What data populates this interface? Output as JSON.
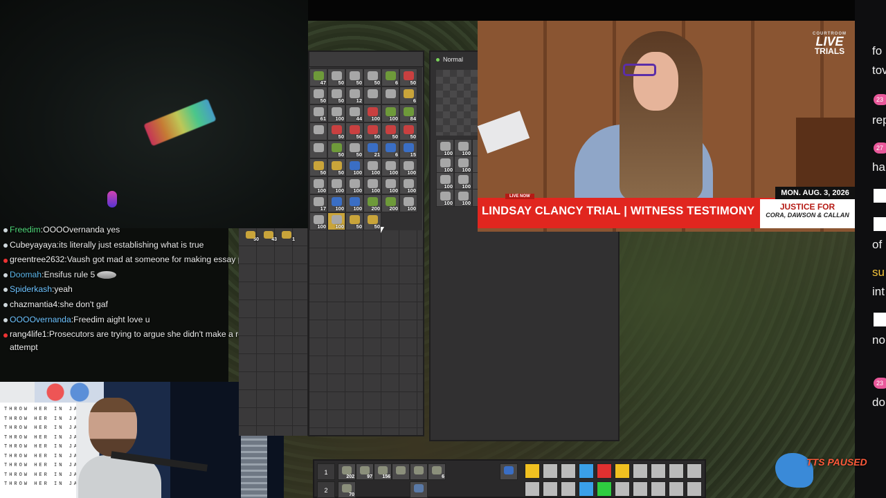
{
  "chat": [
    {
      "user": "Freedim",
      "msg": "OOOOvernanda yes",
      "color": "#4fd87a",
      "badge": "gray"
    },
    {
      "user": "Cubeyayaya",
      "msg": "its literally just establishing what is true",
      "color": "#f0f0f0",
      "badge": "gray"
    },
    {
      "user": "greentree2632",
      "msg": "Vaush got mad at someone for making essay posts",
      "color": "#f0f0f0",
      "badge": "red"
    },
    {
      "user": "Doomah",
      "msg": "Ensifus rule 5",
      "color": "#5ab4e8",
      "badge": "gray",
      "emote": true
    },
    {
      "user": "Spiderkash",
      "msg": "yeah",
      "color": "#6dc3ff",
      "badge": "gray"
    },
    {
      "user": "chazmantia4",
      "msg": "she don't gaf",
      "color": "#f0f0f0",
      "badge": "gray"
    },
    {
      "user": "OOOOvernanda",
      "msg": "Freedim aight love u",
      "color": "#6dc3ff",
      "badge": "gray"
    },
    {
      "user": "rang4life1",
      "msg": "Prosecutors are trying to argue she didn't make a real suicide attempt",
      "color": "#f0f0f0",
      "badge": "red"
    }
  ],
  "poster_line": "THROW HER IN JAIL",
  "inventory": {
    "counts": [
      "47",
      "50",
      "50",
      "50",
      "6",
      "50",
      "50",
      "50",
      "12",
      "",
      "",
      "6",
      "61",
      "100",
      "44",
      "100",
      "100",
      "84",
      "",
      "50",
      "50",
      "50",
      "50",
      "50",
      "",
      "50",
      "50",
      "21",
      "6",
      "15",
      "50",
      "50",
      "100",
      "100",
      "100",
      "100",
      "100",
      "100",
      "100",
      "100",
      "100",
      "100",
      "17",
      "100",
      "100",
      "200",
      "200",
      "100",
      "100",
      "100",
      "50",
      "50"
    ],
    "left_counts": [
      "50",
      "43",
      "1"
    ]
  },
  "panel2": {
    "quality_label": "Normal",
    "counts": [
      "100",
      "100",
      "",
      "100",
      "100",
      "",
      "100",
      "100",
      "",
      "100",
      "100",
      ""
    ]
  },
  "news": {
    "logo_small": "COURTROOM",
    "logo_big": "LIVE",
    "logo_big2": "TRIALS",
    "live_now": "LIVE NOW",
    "headline": "LINDSAY CLANCY TRIAL | WITNESS TESTIMONY",
    "date": "MON. AUG. 3, 2026",
    "justice_title": "JUSTICE FOR",
    "justice_names": "CORA, DAWSON & CALLAN"
  },
  "right_chat": {
    "frag1": "fo",
    "frag2": "tov",
    "pill1": "23",
    "frag3": "rep",
    "pill2": "27",
    "frag4": "ha",
    "frag5": "of",
    "frag6": "su",
    "frag7": "int",
    "frag8": "no",
    "pill3": "23",
    "frag9": "do"
  },
  "toolbar": {
    "row1_num": "1",
    "row2_num": "2",
    "row1_counts": [
      "202",
      "97",
      "156",
      "",
      "",
      "6"
    ],
    "row2_counts": [
      "70"
    ]
  },
  "tts_label": "TTS PAUSED"
}
